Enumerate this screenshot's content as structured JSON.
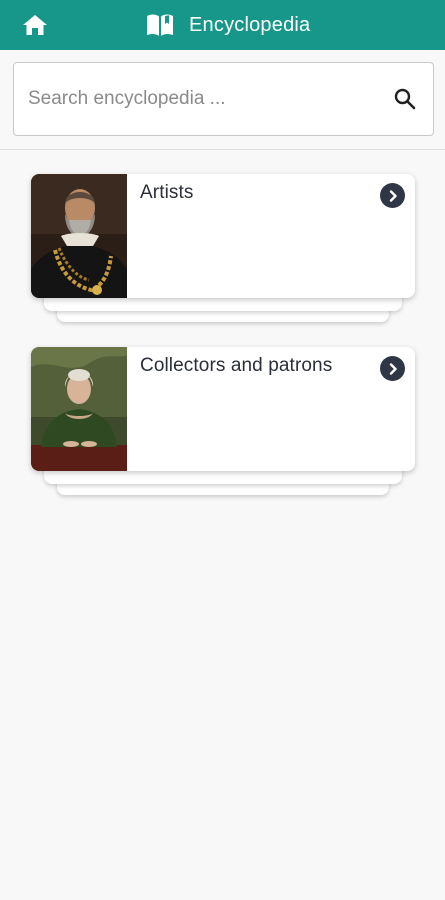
{
  "appbar": {
    "title": "Encyclopedia",
    "home_icon": "home-icon",
    "book_icon": "open-book-icon",
    "color": "#16978a"
  },
  "search": {
    "placeholder": "Search encyclopedia ...",
    "value": "",
    "icon": "search-icon"
  },
  "categories": [
    {
      "label": "Artists",
      "image": "portrait of a bearded man with gold chain",
      "icon": "chevron-right-icon"
    },
    {
      "label": "Collectors and patrons",
      "image": "portrait of a woman in green dress",
      "icon": "chevron-right-icon"
    }
  ],
  "colors": {
    "accent": "#16978a",
    "chevron_bg": "#2f3747",
    "background": "#f8f8f8"
  }
}
